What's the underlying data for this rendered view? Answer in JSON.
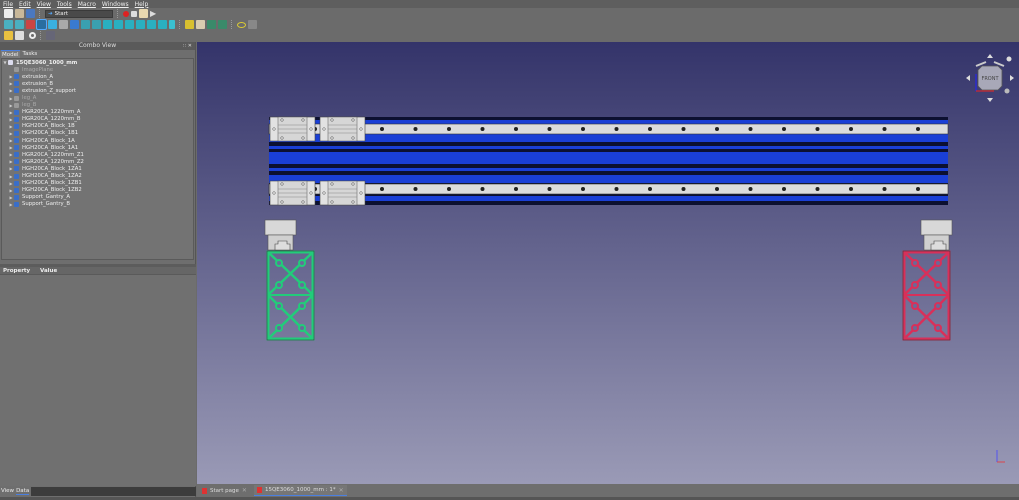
{
  "menu": [
    "File",
    "Edit",
    "View",
    "Tools",
    "Macro",
    "Windows",
    "Help"
  ],
  "toolbar": {
    "workbench": "Start"
  },
  "combo": {
    "title": "Combo View",
    "tabs": [
      "Model",
      "Tasks"
    ]
  },
  "tree": {
    "root": "15QE3060_1000_mm",
    "items": [
      {
        "label": "ImagePlane",
        "dim": true,
        "arrow": false
      },
      {
        "label": "extrusion_A"
      },
      {
        "label": "extrusion_B"
      },
      {
        "label": "extrusion_Z_support"
      },
      {
        "label": "leg_A",
        "dim": true
      },
      {
        "label": "leg_B",
        "dim": true
      },
      {
        "label": "HGR20CA_1220mm_A"
      },
      {
        "label": "HGR20CA_1220mm_B"
      },
      {
        "label": "HGH20CA_Block_1B"
      },
      {
        "label": "HGH20CA_Block_1B1"
      },
      {
        "label": "HGH20CA_Block_1A"
      },
      {
        "label": "HGH20CA_Block_1A1"
      },
      {
        "label": "HGR20CA_1220mm_Z1"
      },
      {
        "label": "HGR20CA_1220mm_Z2"
      },
      {
        "label": "HGH20CA_Block_1ZA1"
      },
      {
        "label": "HGH20CA_Block_1ZA2"
      },
      {
        "label": "HGH20CA_Block_1ZB1"
      },
      {
        "label": "HGH20CA_Block_1ZB2"
      },
      {
        "label": "Support_Gantry_A"
      },
      {
        "label": "Support_Gantry_B"
      }
    ]
  },
  "property": {
    "col1": "Property",
    "col2": "Value"
  },
  "left_tabs": [
    "View",
    "Data"
  ],
  "doc_tabs": [
    {
      "label": "Start page"
    },
    {
      "label": "15QE3060_1000_mm : 1*",
      "active": true
    }
  ],
  "navcube": {
    "face": "FRONT"
  },
  "colors": {
    "rail_blue": "#1a3fd6",
    "profile_left": "#22cc7a",
    "profile_right": "#d8305a",
    "view_top": "#34346a",
    "view_bottom": "#9a9ab6"
  }
}
